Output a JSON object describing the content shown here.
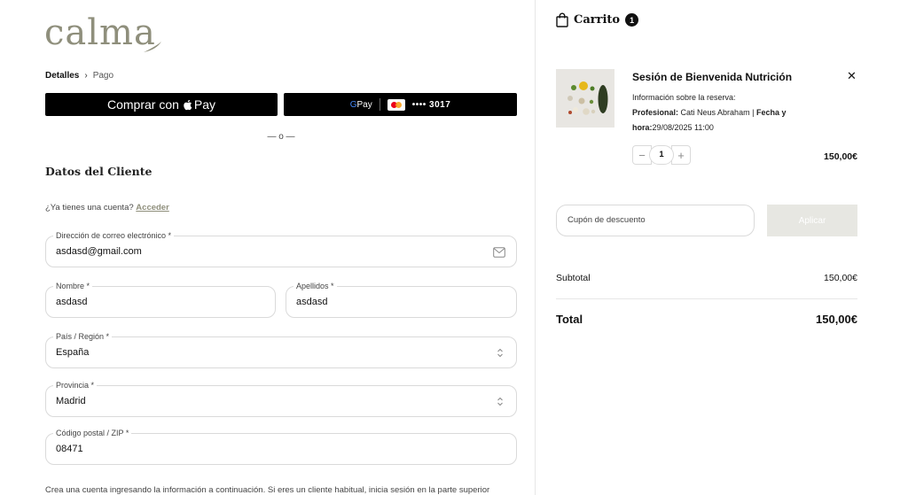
{
  "brand": {
    "logo_text": "calma"
  },
  "breadcrumb": {
    "current": "Detalles",
    "separator": "›",
    "next": "Pago"
  },
  "express": {
    "apple_label": "Comprar con",
    "apple_pay_text": "Pay",
    "gpay_text_g": "G",
    "gpay_text_pay": "Pay",
    "card_masked": "•••• 3017"
  },
  "divider_text": "— o —",
  "customer": {
    "title": "Datos del Cliente",
    "account_prompt": "¿Ya tienes una cuenta?",
    "login_link": "Acceder",
    "email": {
      "label": "Dirección de correo electrónico *",
      "value": "asdasd@gmail.com"
    },
    "first_name": {
      "label": "Nombre *",
      "value": "asdasd"
    },
    "last_name": {
      "label": "Apellidos *",
      "value": "asdasd"
    },
    "country": {
      "label": "País / Región *",
      "value": "España"
    },
    "province": {
      "label": "Provincia *",
      "value": "Madrid"
    },
    "postal": {
      "label": "Código postal / ZIP *",
      "value": "08471"
    },
    "create_account_hint": "Crea una cuenta ingresando la información a continuación. Si eres un cliente habitual, inicia sesión en la parte superior"
  },
  "cart": {
    "title": "Carrito",
    "count": "1",
    "item": {
      "name": "Sesión de Bienvenida Nutrición",
      "info_heading": "Información sobre la reserva:",
      "professional_label": "Profesional:",
      "professional_value": "Cati Neus Abraham",
      "divider": "|",
      "date_label_1": "Fecha y",
      "date_label_2": "hora:",
      "date_value": "29/08/2025 11:00",
      "quantity": "1",
      "minus": "−",
      "plus": "+",
      "remove": "✕",
      "price": "150,00€"
    },
    "coupon_placeholder": "Cupón de descuento",
    "apply_label": "Aplicar",
    "subtotal_label": "Subtotal",
    "subtotal_value": "150,00€",
    "total_label": "Total",
    "total_value": "150,00€"
  },
  "colors": {
    "brand": "#8f8f7c",
    "button_dark": "#000000",
    "apply_disabled": "#e7e7e2"
  }
}
